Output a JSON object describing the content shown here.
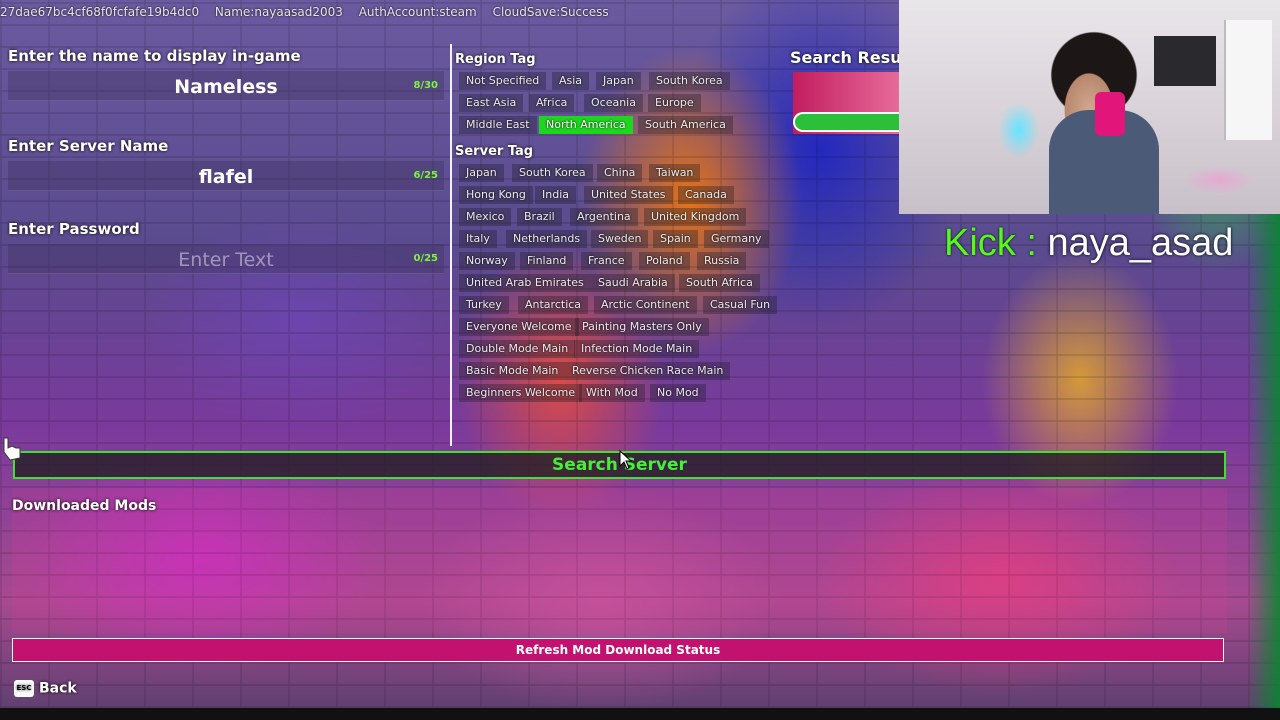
{
  "topinfo": {
    "id": "27dae67bc4cf68f0fcfafe19b4dc0",
    "name": "Name:nayaasad2003",
    "auth": "AuthAccount:steam",
    "cloud": "CloudSave:Success"
  },
  "form": {
    "display_name": {
      "label": "Enter the name to display in-game",
      "value": "Nameless",
      "count": "8/30"
    },
    "server_name": {
      "label": "Enter Server Name",
      "value": "flafel",
      "count": "6/25"
    },
    "password": {
      "label": "Enter Password",
      "placeholder": "Enter Text",
      "count": "0/25"
    }
  },
  "region": {
    "title": "Region Tag",
    "tags": [
      "Not Specified",
      "Asia",
      "Japan",
      "South Korea",
      "East Asia",
      "Africa",
      "Oceania",
      "Europe",
      "Middle East",
      "North America",
      "South America"
    ],
    "selected": "North America"
  },
  "server_tag": {
    "title": "Server Tag",
    "tags": [
      "Japan",
      "South Korea",
      "China",
      "Taiwan",
      "Hong Kong",
      "India",
      "United States",
      "Canada",
      "Mexico",
      "Brazil",
      "Argentina",
      "United Kingdom",
      "Italy",
      "Netherlands",
      "Sweden",
      "Spain",
      "Germany",
      "Norway",
      "Finland",
      "France",
      "Poland",
      "Russia",
      "United Arab Emirates",
      "Saudi Arabia",
      "South Africa",
      "Turkey",
      "Antarctica",
      "Arctic Continent",
      "Casual Fun",
      "Everyone Welcome",
      "Painting Masters Only",
      "Double Mode Main",
      "Infection Mode Main",
      "Basic Mode Main",
      "Reverse Chicken Race Main",
      "Beginners Welcome",
      "With Mod",
      "No Mod"
    ]
  },
  "search_results": {
    "title": "Search Resul"
  },
  "overlay": {
    "brand": "Kick",
    "sep": " : ",
    "handle": "naya_asad"
  },
  "buttons": {
    "search_server": "Search Server",
    "refresh_mods": "Refresh Mod Download Status",
    "back": "Back",
    "back_key": "ESC"
  },
  "downloaded_mods": {
    "title": "Downloaded Mods"
  },
  "colors": {
    "accent_green": "#39e52b",
    "active_tag": "#1dd61d",
    "refresh_button": "#c3116f",
    "kick_green": "#53fc18"
  }
}
